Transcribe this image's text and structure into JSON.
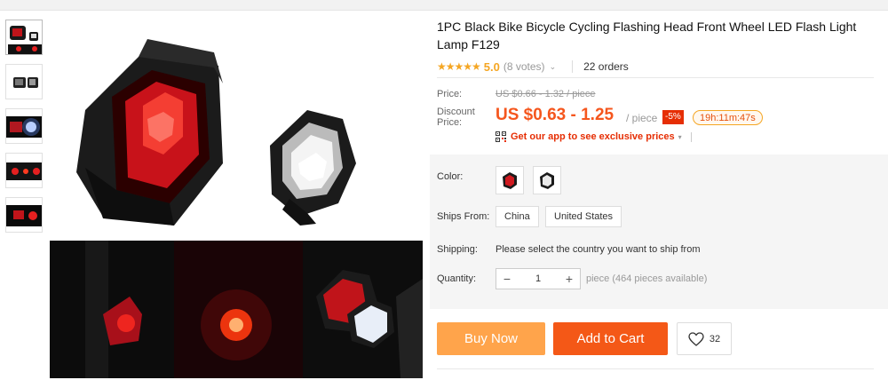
{
  "product": {
    "title": "1PC Black Bike Bicycle Cycling Flashing Head Front Wheel LED Flash Light Lamp F129",
    "stars": "★★★★★",
    "rating": "5.0",
    "votes": "(8 votes)",
    "orders": "22 orders"
  },
  "price": {
    "label": "Price:",
    "original": "US $0.66 - 1.32 / piece",
    "discount_label": "Discount Price:",
    "current": "US $0.63 - 1.25",
    "unit": "/ piece",
    "discount_badge": "-5%",
    "timer": "19h:11m:47s",
    "app_promo": "Get our app to see exclusive prices"
  },
  "options": {
    "color_label": "Color:",
    "ships_from_label": "Ships From:",
    "ships_from": [
      "China",
      "United States"
    ],
    "shipping_label": "Shipping:",
    "shipping_text": "Please select the country you want to ship from",
    "quantity_label": "Quantity:",
    "quantity_minus": "−",
    "quantity_value": "1",
    "quantity_plus": "+",
    "quantity_available": "piece (464 pieces available)"
  },
  "actions": {
    "buy_now": "Buy Now",
    "add_to_cart": "Add to Cart",
    "wishlist_count": "32"
  },
  "icons": {
    "star": "star-icon",
    "heart": "heart-icon",
    "qr": "qr-code-icon",
    "chevron": "chevron-down-icon"
  },
  "colors": {
    "price_orange": "#f5561d",
    "buy_now": "#ffa44b",
    "add_to_cart": "#f45817",
    "badge_red": "#e62e04",
    "star": "#f5a623"
  }
}
